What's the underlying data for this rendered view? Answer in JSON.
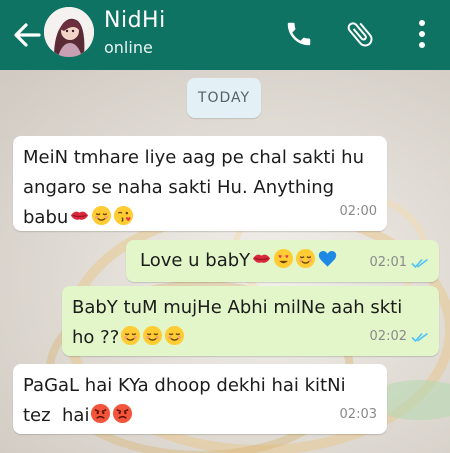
{
  "header": {
    "contact_name": "NidHi",
    "status": "online"
  },
  "date_label": "TODAY",
  "messages": [
    {
      "direction": "in",
      "lines": [
        "MeiN tmhare liye aag pe chal sakti hu",
        "angaro se naha sakti Hu. Anything",
        "babu"
      ],
      "emojis": [
        "kiss-lips",
        "relieved-face",
        "face-blowing-kiss"
      ],
      "time": "02:00"
    },
    {
      "direction": "out",
      "lines": [
        "Love u babY"
      ],
      "emojis": [
        "kiss-lips",
        "heart-eyes-face",
        "relieved-face",
        "blue-heart"
      ],
      "time": "02:01",
      "status": "read"
    },
    {
      "direction": "out",
      "lines": [
        "BabY tuM mujHe Abhi milNe aah skti",
        "ho ??"
      ],
      "emojis": [
        "relieved-face",
        "relieved-face",
        "relieved-face"
      ],
      "time": "02:02",
      "status": "read"
    },
    {
      "direction": "in",
      "lines": [
        "PaGaL hai KYa dhoop dekhi hai kitNi",
        "tez  hai"
      ],
      "emojis": [
        "angry-face",
        "angry-face"
      ],
      "time": "02:03"
    }
  ],
  "colors": {
    "header_bg": "#0e7363",
    "incoming_bubble": "#ffffff",
    "outgoing_bubble": "#e2f6c9",
    "read_ticks": "#4fc3f7"
  }
}
